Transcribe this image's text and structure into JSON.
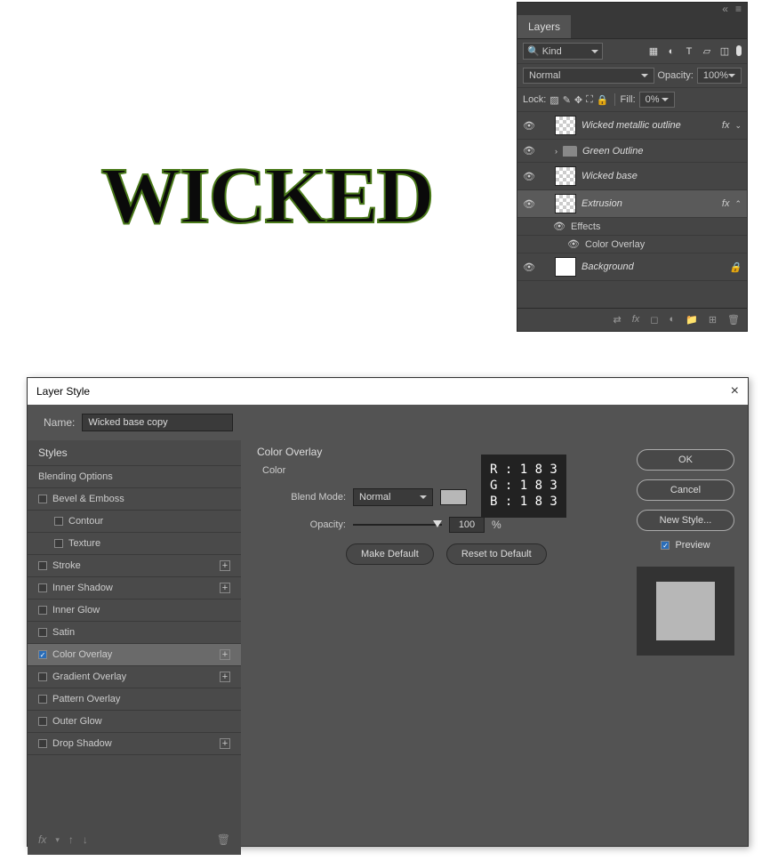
{
  "canvas": {
    "logo_text": "WICKED"
  },
  "layers_panel": {
    "tab": "Layers",
    "filter": {
      "search_icon": "🔍",
      "kind_label": "Kind"
    },
    "blend_mode": "Normal",
    "opacity_label": "Opacity:",
    "opacity_value": "100%",
    "lock_label": "Lock:",
    "fill_label": "Fill:",
    "fill_value": "0%",
    "layers": [
      {
        "name": "Wicked metallic outline",
        "fx": "fx",
        "thumb": "checker",
        "chevron": "⌄"
      },
      {
        "name": "Green Outline",
        "fx": "",
        "thumb": "folder",
        "chevron": "›"
      },
      {
        "name": "Wicked base",
        "fx": "",
        "thumb": "checker"
      },
      {
        "name": "Extrusion",
        "fx": "fx",
        "thumb": "checker",
        "selected": true,
        "chevron": "⌃"
      },
      {
        "name": "Background",
        "fx": "",
        "thumb": "white",
        "locked": true
      }
    ],
    "effects_label": "Effects",
    "effect_item": "Color Overlay"
  },
  "layer_style": {
    "title": "Layer Style",
    "name_label": "Name:",
    "name_value": "Wicked base copy",
    "styles_header": "Styles",
    "blending_options": "Blending Options",
    "effects": [
      {
        "label": "Bevel & Emboss",
        "checked": false,
        "plus": false
      },
      {
        "label": "Contour",
        "checked": false,
        "plus": false,
        "sub": true
      },
      {
        "label": "Texture",
        "checked": false,
        "plus": false,
        "sub": true
      },
      {
        "label": "Stroke",
        "checked": false,
        "plus": true
      },
      {
        "label": "Inner Shadow",
        "checked": false,
        "plus": true
      },
      {
        "label": "Inner Glow",
        "checked": false,
        "plus": false
      },
      {
        "label": "Satin",
        "checked": false,
        "plus": false
      },
      {
        "label": "Color Overlay",
        "checked": true,
        "plus": true,
        "selected": true
      },
      {
        "label": "Gradient Overlay",
        "checked": false,
        "plus": true
      },
      {
        "label": "Pattern Overlay",
        "checked": false,
        "plus": false
      },
      {
        "label": "Outer Glow",
        "checked": false,
        "plus": false
      },
      {
        "label": "Drop Shadow",
        "checked": false,
        "plus": true
      }
    ],
    "fx_label": "fx",
    "section_title": "Color Overlay",
    "sub_section": "Color",
    "blend_mode_label": "Blend Mode:",
    "blend_mode_value": "Normal",
    "opacity_label": "Opacity:",
    "opacity_value": "100",
    "opacity_unit": "%",
    "make_default": "Make Default",
    "reset_default": "Reset to Default",
    "rgb": {
      "r": "R : 1 8 3",
      "g": "G : 1 8 3",
      "b": "B : 1 8 3"
    },
    "buttons": {
      "ok": "OK",
      "cancel": "Cancel",
      "new_style": "New Style...",
      "preview": "Preview"
    }
  }
}
